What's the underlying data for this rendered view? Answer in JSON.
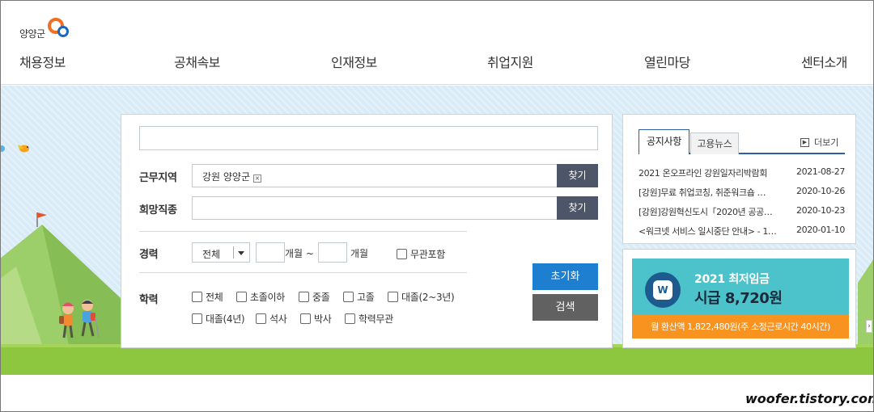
{
  "logo": {
    "text": "양양군"
  },
  "nav": [
    "채용정보",
    "공채속보",
    "인재정보",
    "취업지원",
    "열린마당",
    "센터소개"
  ],
  "search": {
    "keyword_value": "",
    "region": {
      "label": "근무지역",
      "tag": "강원 양양군",
      "find": "찾기"
    },
    "job": {
      "label": "희망직종",
      "find": "찾기"
    },
    "career": {
      "label": "경력",
      "select_value": "전체",
      "unit1": "개월 ~",
      "unit2": "개월",
      "any_label": "무관포함"
    },
    "education": {
      "label": "학력",
      "options": [
        "전체",
        "초졸이하",
        "중졸",
        "고졸",
        "대졸(2~3년)",
        "대졸(4년)",
        "석사",
        "박사",
        "학력무관"
      ]
    },
    "reset_label": "초기화",
    "search_label": "검색"
  },
  "notice": {
    "tabs": [
      "공지사항",
      "고용뉴스"
    ],
    "more_label": "더보기",
    "items": [
      {
        "title": "2021 온오프라인 강원일자리박람회",
        "date": "2021-08-27"
      },
      {
        "title": "[강원]무료 취업코칭, 취준워크숍 …",
        "date": "2020-10-26"
      },
      {
        "title": "[강원]강원혁신도시「2020년 공공…",
        "date": "2020-10-23"
      },
      {
        "title": "<워크넷 서비스 일시중단 안내> - 1…",
        "date": "2020-01-10"
      }
    ]
  },
  "wage": {
    "title": "2021 최저임금",
    "hourly": "시급 8,720원",
    "monthly": "월 환산액 1,822,480원(주 소정근로시간 40시간)",
    "icon_text": "W"
  },
  "watermark": "woofer.tistory.com",
  "colors": {
    "primary_blue": "#1e7fd0",
    "dark_btn": "#4d5569",
    "search_btn": "#616161",
    "orange": "#f7931e",
    "teal": "#4cc3cb",
    "grass": "#8dc63f",
    "sky": "#d9ebf6"
  }
}
